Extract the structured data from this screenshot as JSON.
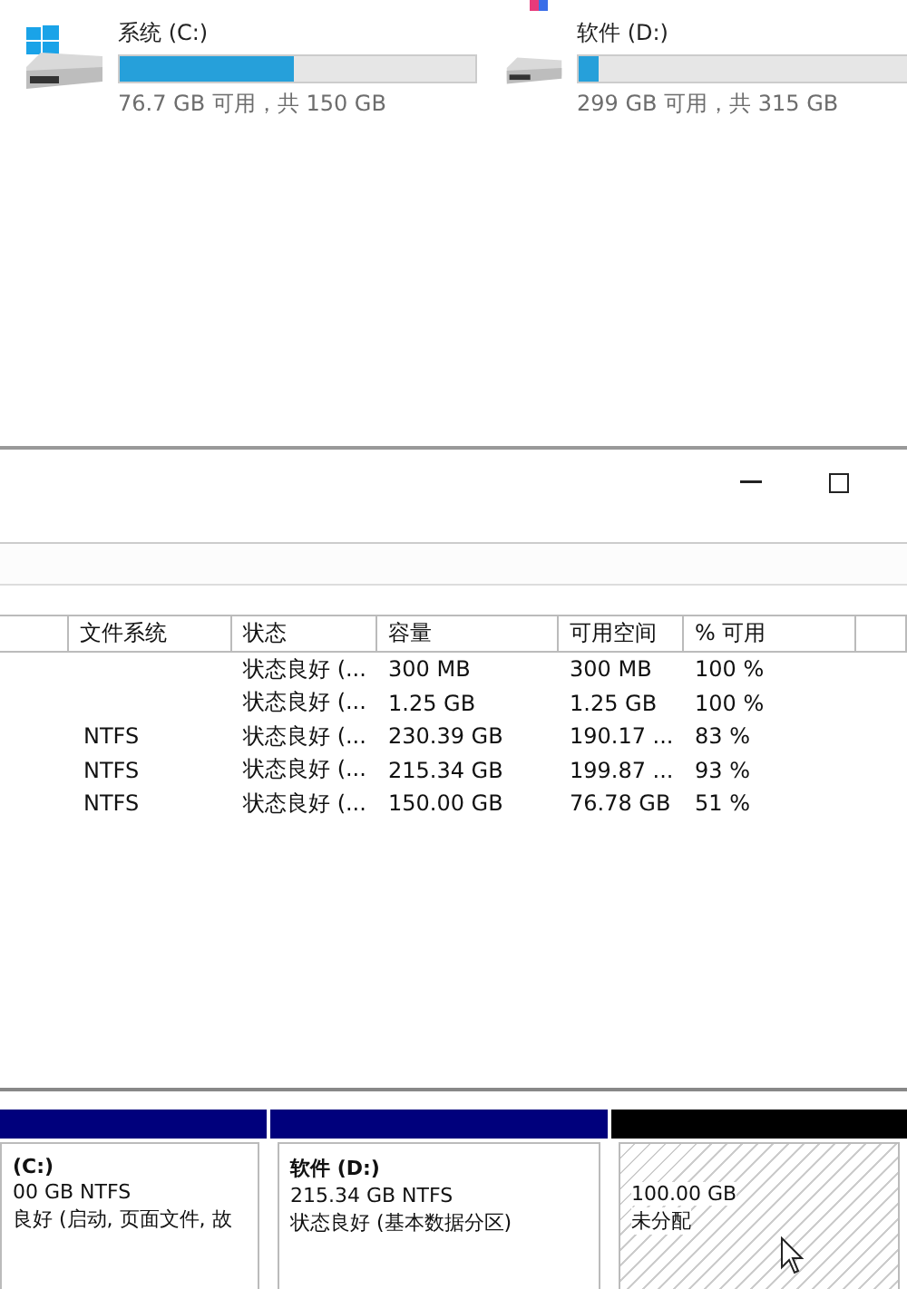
{
  "drives": [
    {
      "kind": "system",
      "name": "系统 (C:)",
      "level": 0.49,
      "summary": "76.7 GB 可用，共 150 GB"
    },
    {
      "kind": "data",
      "name": "软件 (D:)",
      "level": 0.05,
      "summary": "299 GB 可用，共 315 GB"
    }
  ],
  "window": {
    "controls": [
      {
        "kind": "minimize"
      },
      {
        "kind": "maximize"
      }
    ]
  },
  "table": {
    "columns": [
      "",
      "文件系统",
      "状态",
      "容量",
      "可用空间",
      "% 可用",
      ""
    ],
    "rows": [
      [
        "",
        "",
        "状态良好 (...",
        "300 MB",
        "300 MB",
        "100 %"
      ],
      [
        "",
        "",
        "状态良好 (...",
        "1.25 GB",
        "1.25 GB",
        "100 %"
      ],
      [
        "",
        "NTFS",
        "状态良好 (...",
        "230.39 GB",
        "190.17 ...",
        "83 %"
      ],
      [
        "",
        "NTFS",
        "状态良好 (...",
        "215.34 GB",
        "199.87 ...",
        "93 %"
      ],
      [
        "",
        "NTFS",
        "状态良好 (...",
        "150.00 GB",
        "76.78 GB",
        "51 %"
      ]
    ]
  },
  "partitions": [
    {
      "kind": "primary",
      "name": "(C:)",
      "size": "00 GB NTFS",
      "status": "良好 (启动, 页面文件, 故"
    },
    {
      "kind": "primary",
      "name": "软件  (D:)",
      "size": "215.34 GB NTFS",
      "status": "状态良好 (基本数据分区)"
    },
    {
      "kind": "unallocated",
      "size": "100.00 GB",
      "status": "未分配"
    }
  ]
}
